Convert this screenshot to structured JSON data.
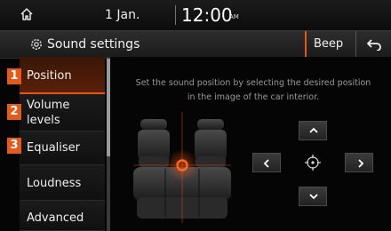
{
  "status": {
    "date": "1 Jan.",
    "time": "12:00",
    "ampm": "AM"
  },
  "title_bar": {
    "title": "Sound settings",
    "beep_label": "Beep"
  },
  "sidebar": {
    "items": [
      {
        "label": "Position",
        "badge": "1"
      },
      {
        "label": "Volume\nlevels",
        "badge": "2"
      },
      {
        "label": "Equaliser",
        "badge": "3"
      },
      {
        "label": "Loudness"
      },
      {
        "label": "Advanced"
      }
    ],
    "selected": "Position"
  },
  "main": {
    "instruction": "Set the sound position by selecting the desired position in the image of the car interior."
  },
  "colors": {
    "accent": "#e8541a",
    "badge": "#e35b1c"
  }
}
